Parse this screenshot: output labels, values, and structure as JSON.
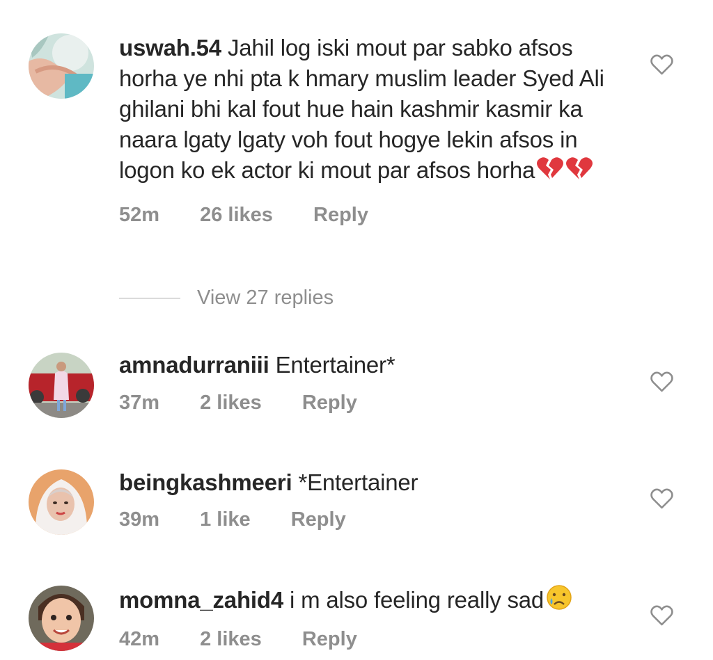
{
  "comments": [
    {
      "username": "uswah.54",
      "text": "Jahil log iski mout par sabko afsos horha ye nhi pta k hmary muslim leader Syed Ali ghilani bhi kal fout hue hain kashmir kasmir ka naara lgaty lgaty voh fout hogye lekin afsos in logon ko ek actor ki mout par afsos horha",
      "time": "52m",
      "likes": "26 likes",
      "reply": "Reply",
      "view_replies": "View 27 replies"
    },
    {
      "username": "amnadurraniii",
      "text": "Entertainer*",
      "time": "37m",
      "likes": "2 likes",
      "reply": "Reply"
    },
    {
      "username": "beingkashmeeri",
      "text": "*Entertainer",
      "time": "39m",
      "likes": "1 like",
      "reply": "Reply"
    },
    {
      "username": "momna_zahid4",
      "text": "i m also feeling really sad",
      "time": "42m",
      "likes": "2 likes",
      "reply": "Reply"
    }
  ],
  "icons": {
    "like": "heart-outline-icon",
    "broken_heart": "broken-heart-emoji",
    "sad_face": "crying-face-emoji"
  },
  "colors": {
    "text": "#262626",
    "meta": "#8e8e8e",
    "divider": "#dbdbdb"
  }
}
